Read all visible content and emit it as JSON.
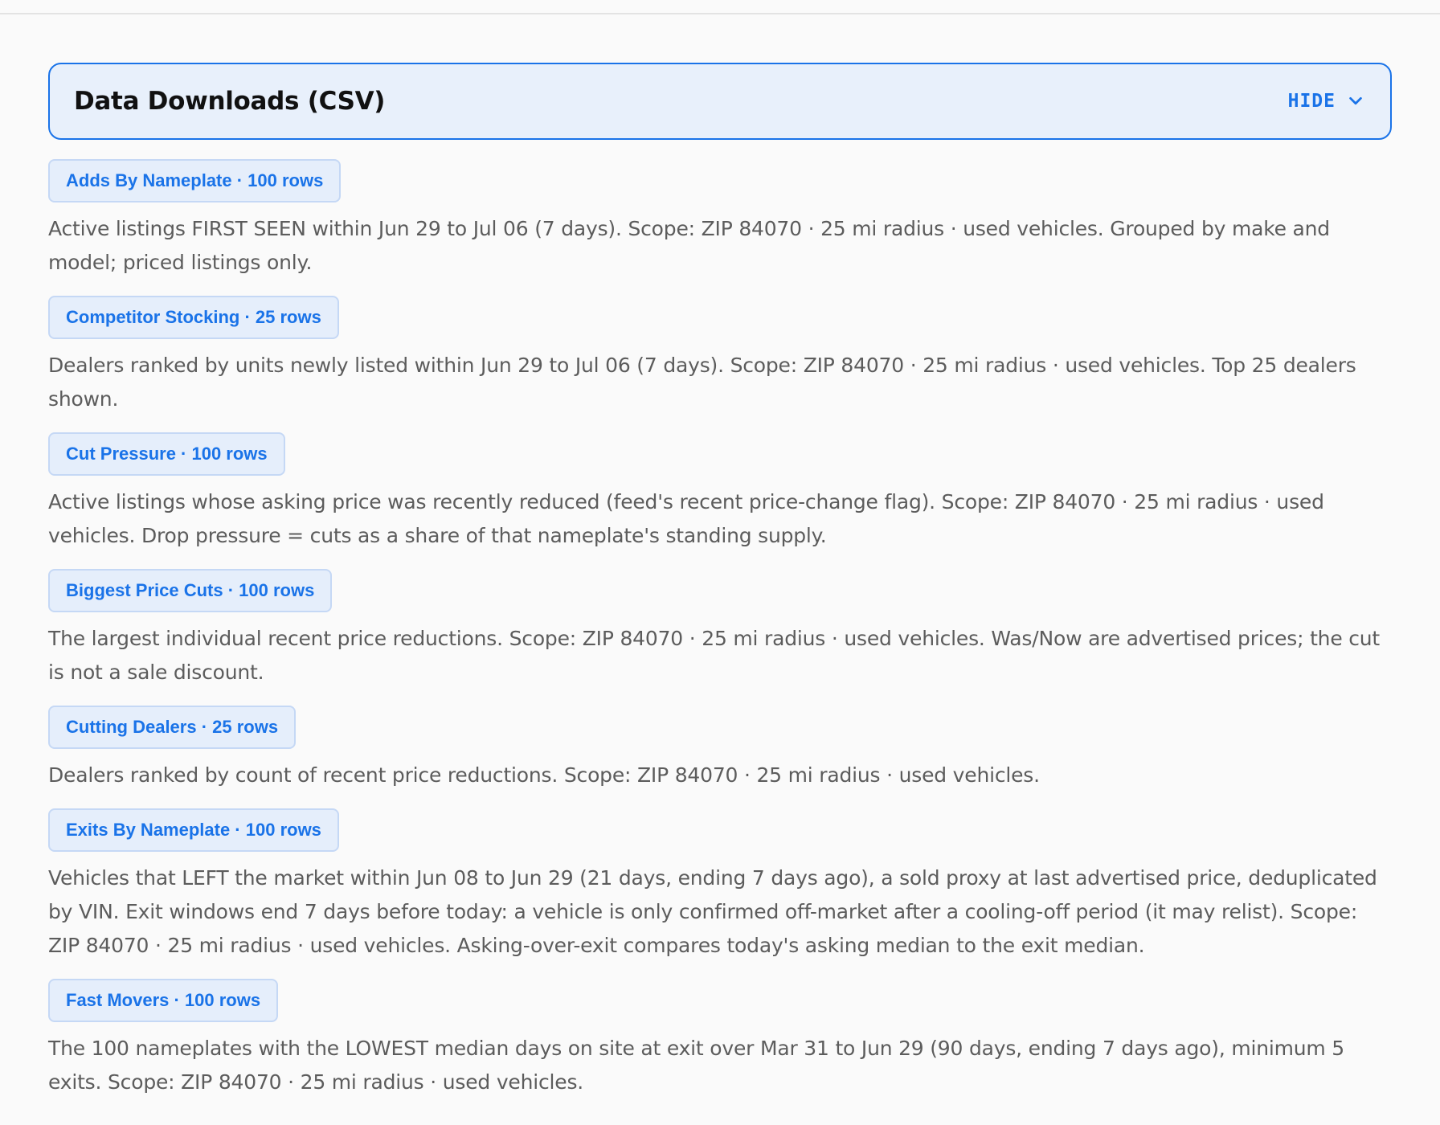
{
  "section": {
    "title": "Data Downloads (CSV)",
    "toggle_label": "HIDE"
  },
  "downloads": [
    {
      "label": "Adds By Nameplate · 100 rows",
      "description": "Active listings FIRST SEEN within Jun 29 to Jul 06 (7 days). Scope: ZIP 84070 · 25 mi radius · used vehicles. Grouped by make and model; priced listings only."
    },
    {
      "label": "Competitor Stocking · 25 rows",
      "description": "Dealers ranked by units newly listed within Jun 29 to Jul 06 (7 days). Scope: ZIP 84070 · 25 mi radius · used vehicles. Top 25 dealers shown."
    },
    {
      "label": "Cut Pressure · 100 rows",
      "description": "Active listings whose asking price was recently reduced (feed's recent price-change flag). Scope: ZIP 84070 · 25 mi radius · used vehicles. Drop pressure = cuts as a share of that nameplate's standing supply."
    },
    {
      "label": "Biggest Price Cuts · 100 rows",
      "description": "The largest individual recent price reductions. Scope: ZIP 84070 · 25 mi radius · used vehicles. Was/Now are advertised prices; the cut is not a sale discount."
    },
    {
      "label": "Cutting Dealers · 25 rows",
      "description": "Dealers ranked by count of recent price reductions. Scope: ZIP 84070 · 25 mi radius · used vehicles."
    },
    {
      "label": "Exits By Nameplate · 100 rows",
      "description": "Vehicles that LEFT the market within Jun 08 to Jun 29 (21 days, ending 7 days ago), a sold proxy at last advertised price, deduplicated by VIN. Exit windows end 7 days before today: a vehicle is only confirmed off-market after a cooling-off period (it may relist). Scope: ZIP 84070 · 25 mi radius · used vehicles. Asking-over-exit compares today's asking median to the exit median."
    },
    {
      "label": "Fast Movers · 100 rows",
      "description": "The 100 nameplates with the LOWEST median days on site at exit over Mar 31 to Jun 29 (90 days, ending 7 days ago), minimum 5 exits. Scope: ZIP 84070 · 25 mi radius · used vehicles."
    }
  ],
  "colors": {
    "accent": "#1a73e8",
    "header_bg": "#e8f0fb",
    "button_bg": "#e5eefb",
    "button_border": "#c5d8f5",
    "page_bg": "#fafafa",
    "body_text": "#5c5c5c",
    "title_text": "#111111"
  },
  "icons": {
    "toggle": "chevron-down-icon"
  }
}
